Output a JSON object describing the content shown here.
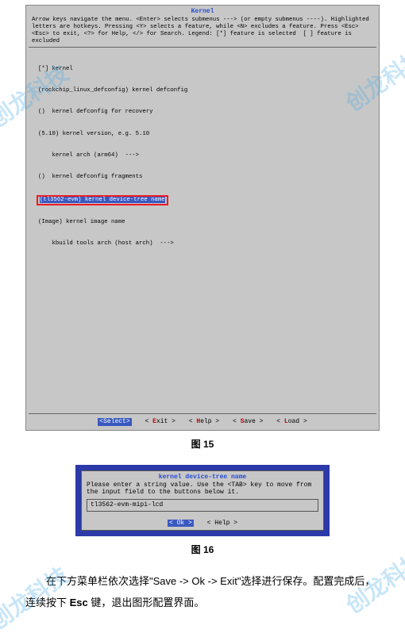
{
  "term1": {
    "title": "Kernel",
    "help": "Arrow keys navigate the menu. <Enter> selects submenus ---> (or empty submenus ----). Highlighted letters are hotkeys. Pressing <Y> selects a feature, while <N> excludes a feature. Press <Esc><Esc> to exit, <?> for Help, </> for Search. Legend: [*] feature is selected  [ ] feature is excluded",
    "items": [
      "[*] kernel",
      "(rockchip_linux_defconfig) kernel defconfig",
      "()  kernel defconfig for recovery",
      "(5.10) kernel version, e.g. 5.10",
      "    kernel arch (arm64)  --->",
      "()  kernel defconfig fragments",
      "(tl3562-evm) kernel device-tree name",
      "(Image) kernel image name",
      "    kbuild tools arch (host arch)  --->"
    ],
    "buttons": {
      "select": "<Select>",
      "exit": "< Exit >",
      "help": "< Help >",
      "save": "< Save >",
      "load": "< Load >"
    }
  },
  "caption1": "图 15",
  "dialog": {
    "title": "kernel device-tree name",
    "help": "Please enter a string value. Use the <TAB> key to move from the input field to the buttons below it.",
    "value": "tl3562-evm-mipi-lcd",
    "buttons": {
      "ok": "<  Ok  >",
      "help": "< Help >"
    }
  },
  "caption2": "图 16",
  "body": {
    "prefix": "在下方菜单栏依次选择\"Save -> Ok -> Exit\"选择进行保存。配置完成后，连续按下 ",
    "bold1": "Esc",
    "after1": " 键，退出图形配置界面。"
  },
  "watermark": "创龙科技"
}
